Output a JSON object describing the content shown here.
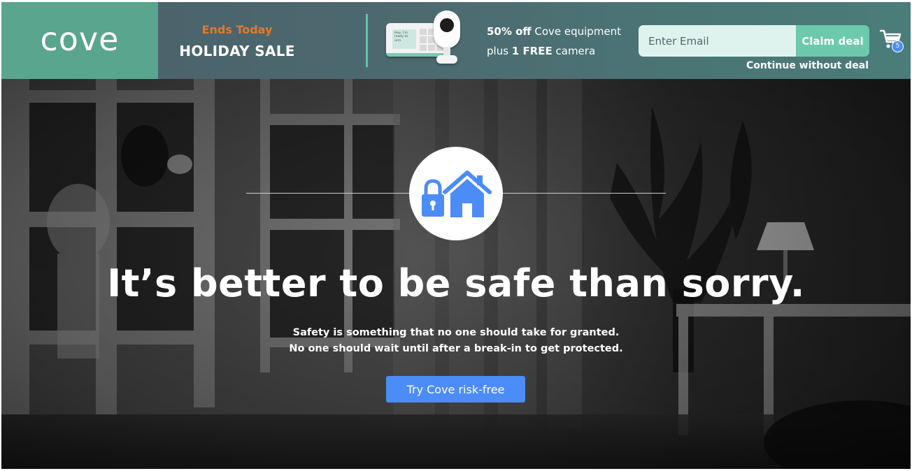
{
  "banner": {
    "logo": "cove",
    "eyebrow": "Ends Today",
    "sale_title": "HOLIDAY SALE",
    "product_screen_text": "Hey, I'm ready to arm.",
    "offer": {
      "line1_bold": "50% off",
      "line1_rest": " Cove equipment",
      "line2_pre": "plus ",
      "line2_bold": "1 FREE",
      "line2_rest": " camera"
    },
    "email_placeholder": "Enter Email",
    "claim_label": "Claim deal",
    "continue_label": "Continue without deal",
    "cart_count": "5",
    "colors": {
      "logo_bg": "#5aa58d",
      "eyebrow": "#e07a2e",
      "accent": "#5fc4a8",
      "claim_button": "#6cc9ab",
      "cart_badge": "#4a8ff2"
    }
  },
  "hero": {
    "icon": "lock-house-icon",
    "headline": "It’s better to be safe than sorry.",
    "subline1": "Safety is something that no one should take for granted.",
    "subline2": "No one should wait until after a break-in to get protected.",
    "cta_label": "Try Cove risk-free",
    "colors": {
      "icon": "#4b8cf7",
      "cta": "#4b8cf7"
    }
  }
}
